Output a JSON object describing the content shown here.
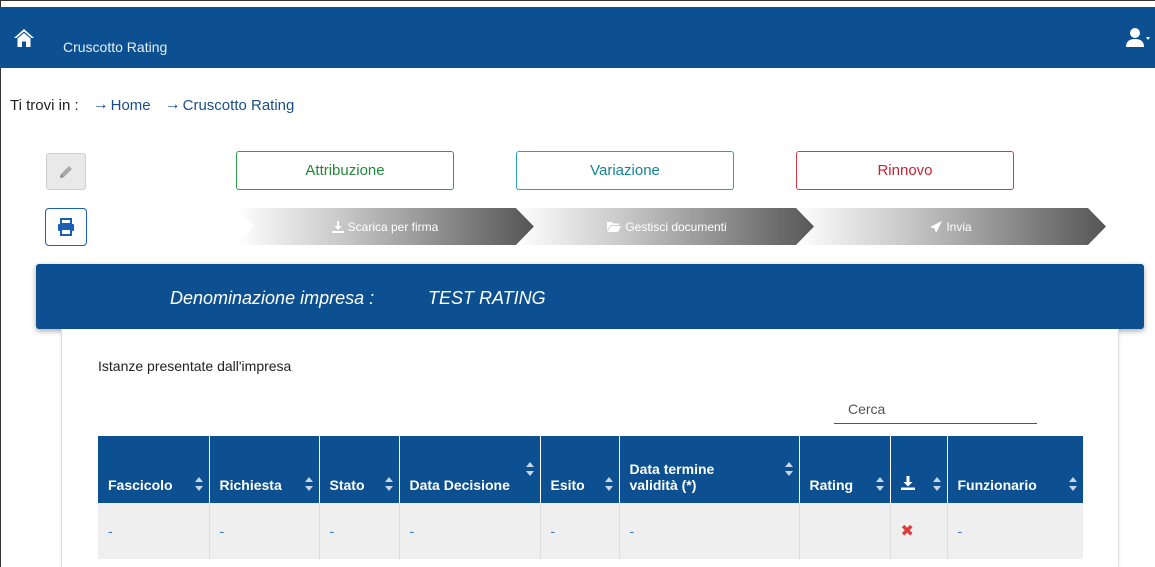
{
  "navbar": {
    "title": "Cruscotto Rating",
    "home_icon": "home-icon",
    "user_icon": "user-icon"
  },
  "breadcrumb": {
    "prefix": "Ti trovi in :",
    "items": [
      "Home",
      "Cruscotto Rating"
    ]
  },
  "actions": {
    "attribuzione": "Attribuzione",
    "variazione": "Variazione",
    "rinnovo": "Rinnovo"
  },
  "steps": [
    "Scarica per firma",
    "Gestisci documenti",
    "Invia"
  ],
  "company": {
    "label": "Denominazione impresa :",
    "value": "TEST RATING"
  },
  "section": {
    "title": "Istanze presentate dall'impresa"
  },
  "search": {
    "placeholder": "Cerca"
  },
  "table": {
    "headers": [
      "Fascicolo",
      "Richiesta",
      "Stato",
      "Data Decisione",
      "Esito",
      "Data termine validità (*)",
      "Rating",
      "",
      "Funzionario"
    ],
    "download_header_icon": "download-icon",
    "rows": [
      [
        "-",
        "-",
        "-",
        "-",
        "-",
        "-",
        "",
        "✖",
        "-"
      ]
    ]
  },
  "colors": {
    "primary": "#0d5092",
    "green": "#2e9d4e",
    "teal": "#2aa2b8",
    "red": "#dc3545"
  }
}
